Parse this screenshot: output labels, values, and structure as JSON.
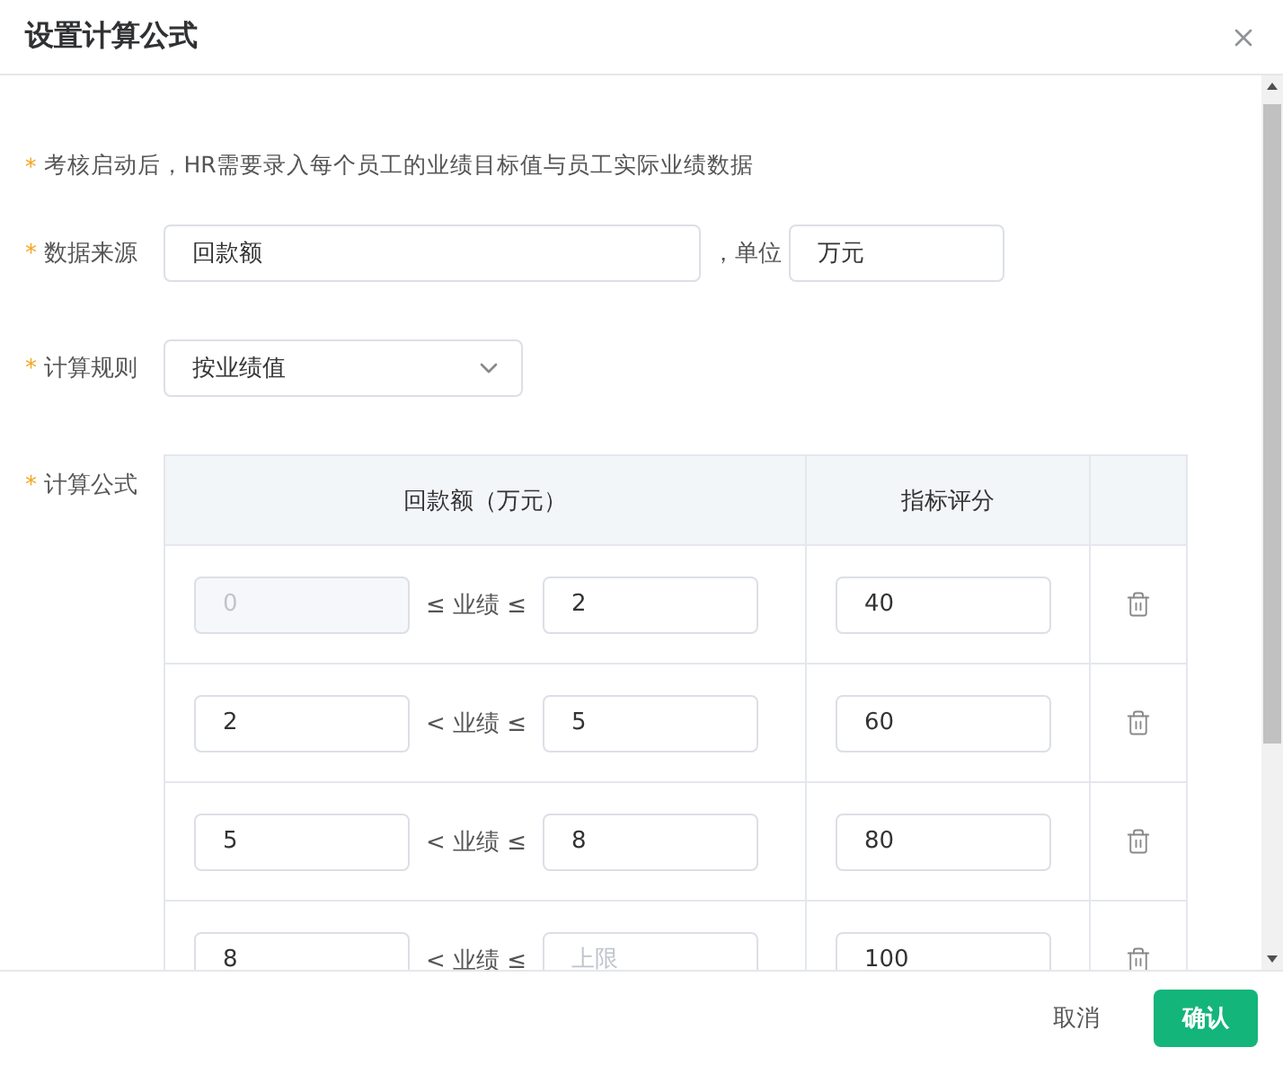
{
  "dialog": {
    "title": "设置计算公式"
  },
  "note": {
    "required_mark": "*",
    "text": "考核启动后，HR需要录入每个员工的业绩目标值与员工实际业绩数据"
  },
  "fields": [
    {
      "kind": "text",
      "label": "数据来源",
      "required_mark": "*",
      "value": "回款额",
      "unit_label": "，单位",
      "unit_value": "万元"
    },
    {
      "kind": "select",
      "label": "计算规则",
      "required_mark": "*",
      "value": "按业绩值"
    }
  ],
  "formula": {
    "label": "计算公式",
    "required_mark": "*",
    "columns": [
      "回款额（万元）",
      "指标评分"
    ],
    "rows": [
      {
        "lower": "0",
        "lower_disabled": true,
        "operator": "≤ 业绩 ≤",
        "upper": "2",
        "score": "40"
      },
      {
        "lower": "2",
        "lower_disabled": false,
        "operator": "< 业绩 ≤",
        "upper": "5",
        "score": "60"
      },
      {
        "lower": "5",
        "lower_disabled": false,
        "operator": "< 业绩 ≤",
        "upper": "8",
        "score": "80"
      },
      {
        "lower": "8",
        "lower_disabled": false,
        "operator": "< 业绩 ≤",
        "upper_placeholder": "上限",
        "score": "100"
      }
    ]
  },
  "footer": {
    "buttons": [
      {
        "label": "取消",
        "kind": "text"
      },
      {
        "label": "确认",
        "kind": "primary"
      }
    ]
  }
}
